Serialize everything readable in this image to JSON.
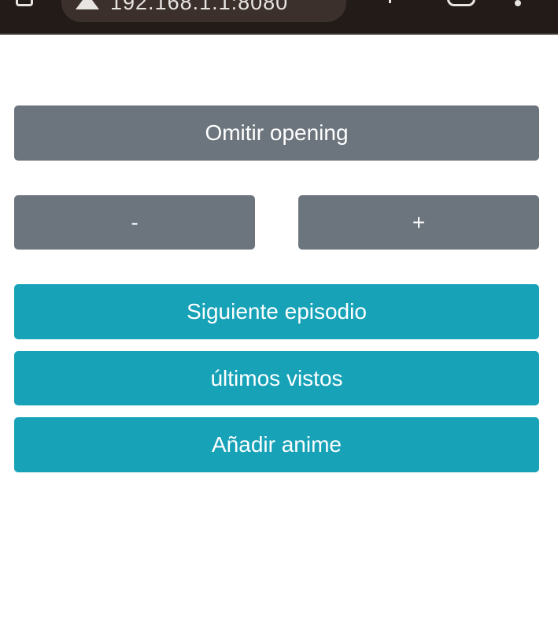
{
  "browser": {
    "url": "192.168.1.1:8080"
  },
  "controls": {
    "skip_opening_label": "Omitir opening",
    "decrement_label": "-",
    "increment_label": "+",
    "next_episode_label": "Siguiente episodio",
    "recently_watched_label": "últimos vistos",
    "add_anime_label": "Añadir anime"
  },
  "colors": {
    "secondary_button": "#6c757d",
    "info_button": "#17a2b8",
    "browser_toolbar": "#221b18"
  },
  "icons": {
    "tab_switcher": "tab-switcher-icon",
    "warning": "warning-icon",
    "add_tab": "add-tab-icon",
    "tabs_count": "tabs-count-icon",
    "menu": "more-vert-icon"
  }
}
